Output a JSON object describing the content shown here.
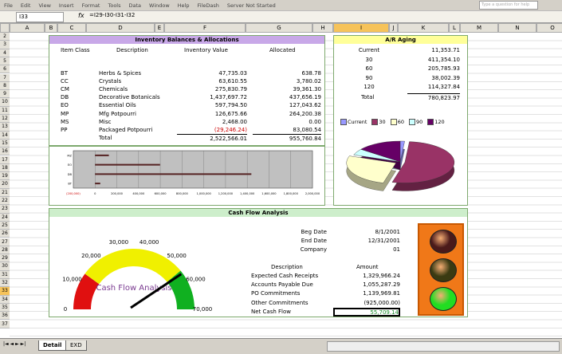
{
  "menu": [
    "File",
    "Edit",
    "View",
    "Insert",
    "Format",
    "Tools",
    "Data",
    "Window",
    "Help",
    "FileDash",
    "Server Not Started"
  ],
  "ask_placeholder": "Type a question for help",
  "formula_bar": {
    "cell_ref": "I33",
    "fx": "fx",
    "formula": "=I29-I30-I31-I32"
  },
  "columns": [
    {
      "label": "A",
      "w": 44
    },
    {
      "label": "B",
      "w": 16
    },
    {
      "label": "C",
      "w": 36
    },
    {
      "label": "D",
      "w": 86
    },
    {
      "label": "E",
      "w": 12
    },
    {
      "label": "F",
      "w": 102
    },
    {
      "label": "G",
      "w": 84
    },
    {
      "label": "H",
      "w": 26
    },
    {
      "label": "I",
      "w": 70
    },
    {
      "label": "J",
      "w": 11
    },
    {
      "label": "K",
      "w": 64
    },
    {
      "label": "L",
      "w": 14
    },
    {
      "label": "M",
      "w": 48
    },
    {
      "label": "N",
      "w": 48
    },
    {
      "label": "O",
      "w": 40
    }
  ],
  "selected_column": "I",
  "selected_row": "33",
  "rows": [
    "2",
    "3",
    "4",
    "5",
    "6",
    "7",
    "8",
    "9",
    "10",
    "11",
    "12",
    "13",
    "14",
    "15",
    "16",
    "17",
    "18",
    "19",
    "20",
    "21",
    "22",
    "23",
    "24",
    "25",
    "26",
    "27",
    "28",
    "29",
    "30",
    "31",
    "32",
    "33",
    "34",
    "35",
    "36",
    "37"
  ],
  "inventory": {
    "title": "Inventory Balances & Allocations",
    "headers": [
      "Item Class",
      "Description",
      "Inventory Value",
      "Allocated"
    ],
    "items": [
      {
        "cls": "BT",
        "desc": "Herbs & Spices",
        "value": "47,735.03",
        "alloc": "638.78"
      },
      {
        "cls": "CC",
        "desc": "Crystals",
        "value": "63,610.55",
        "alloc": "3,780.02"
      },
      {
        "cls": "CM",
        "desc": "Chemicals",
        "value": "275,830.79",
        "alloc": "39,361.30"
      },
      {
        "cls": "DB",
        "desc": "Decorative Botanicals",
        "value": "1,437,697.72",
        "alloc": "437,656.19"
      },
      {
        "cls": "EO",
        "desc": "Essential Oils",
        "value": "597,794.50",
        "alloc": "127,043.62"
      },
      {
        "cls": "MP",
        "desc": "Mfg Potpourri",
        "value": "126,675.66",
        "alloc": "264,200.38"
      },
      {
        "cls": "MS",
        "desc": "Misc",
        "value": "2,468.00",
        "alloc": "0.00"
      },
      {
        "cls": "PP",
        "desc": "Packaged Potpourri",
        "value": "(29,246.24)",
        "alloc": "83,080.54",
        "neg": true
      }
    ],
    "total_label": "Total",
    "total_value": "2,522,566.01",
    "total_alloc": "955,760.84"
  },
  "bar_chart": {
    "type": "bar",
    "categories": [
      "MZ",
      "EO",
      "DB",
      "BT"
    ],
    "series": [
      {
        "values": [
          126675.66,
          597794.5,
          1437697.72,
          47735.03
        ]
      }
    ],
    "x_ticks": [
      "(200,000)",
      "0",
      "200,000",
      "400,000",
      "600,000",
      "800,000",
      "1,000,000",
      "1,200,000",
      "1,400,000",
      "1,600,000",
      "1,800,000",
      "2,000,000"
    ],
    "xlim": [
      -200000,
      2000000
    ]
  },
  "ar_aging": {
    "title": "A/R Aging",
    "rows": [
      {
        "label": "Current",
        "amount": "11,353.71"
      },
      {
        "label": "30",
        "amount": "411,354.10"
      },
      {
        "label": "60",
        "amount": "205,785.93"
      },
      {
        "label": "90",
        "amount": "38,002.39"
      },
      {
        "label": "120",
        "amount": "114,327.84"
      }
    ],
    "total_label": "Total",
    "total_amount": "780,823.97"
  },
  "pie_chart": {
    "type": "pie",
    "legend": [
      "Current",
      "30",
      "60",
      "90",
      "120"
    ],
    "values": [
      11353.71,
      411354.1,
      205785.93,
      38002.39,
      114327.84
    ],
    "colors": [
      "#9999ff",
      "#993366",
      "#ffffcc",
      "#ccffff",
      "#660066"
    ]
  },
  "cash_flow": {
    "title": "Cash Flow Analysis",
    "gauge_ticks": [
      "0",
      "10,000",
      "20,000",
      "30,000",
      "40,000",
      "50,000",
      "60,000",
      "70,000"
    ],
    "gauge_label": "Cash Flow Analysis",
    "gauge_value": 55709.14,
    "gauge_max": 70000,
    "beg_date_label": "Beg Date",
    "beg_date": "8/1/2001",
    "end_date_label": "End Date",
    "end_date": "12/31/2001",
    "company_label": "Company",
    "company": "01",
    "desc_header": "Description",
    "amount_header": "Amount",
    "lines": [
      {
        "desc": "Expected Cash Receipts",
        "amount": "1,329,966.24"
      },
      {
        "desc": "Accounts Payable Due",
        "amount": "1,055,287.29"
      },
      {
        "desc": "PO Commitments",
        "amount": "1,139,969.81"
      },
      {
        "desc": "Other Commitments",
        "amount": "(925,000.00)"
      }
    ],
    "net_label": "Net Cash Flow",
    "net_amount": "55,709.14",
    "traffic": [
      "#4a1a1a",
      "#3a3a12",
      "#22dd22"
    ]
  },
  "tabs": {
    "nav": "|◄ ◄ ► ►|",
    "sheets": [
      "Detail",
      "EXD"
    ],
    "active": "Detail"
  }
}
